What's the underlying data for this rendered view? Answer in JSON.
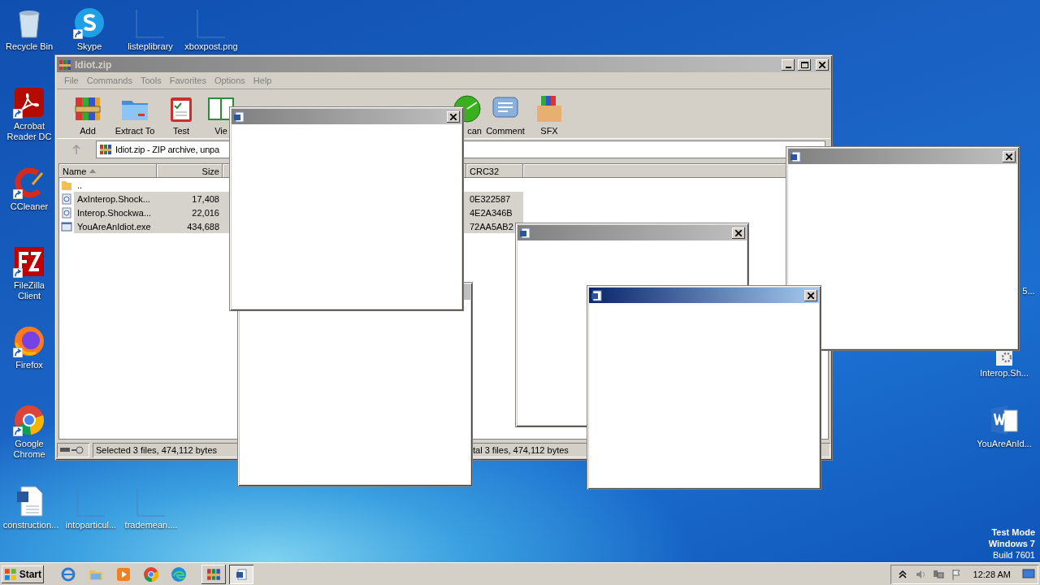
{
  "desktop_icons": [
    {
      "label": "Recycle Bin",
      "kind": "recycle-bin",
      "shortcut": false
    },
    {
      "label": "Skype",
      "kind": "skype",
      "shortcut": true
    },
    {
      "label": "listeplibrary",
      "kind": "blank",
      "shortcut": false
    },
    {
      "label": "xboxpost.png",
      "kind": "blank",
      "shortcut": false
    },
    {
      "label": "Acrobat Reader DC",
      "kind": "acrobat",
      "shortcut": true
    },
    {
      "label": "CCleaner",
      "kind": "ccleaner",
      "shortcut": true
    },
    {
      "label": "FileZilla Client",
      "kind": "filezilla",
      "shortcut": true
    },
    {
      "label": "Firefox",
      "kind": "firefox",
      "shortcut": true
    },
    {
      "label": "Google Chrome",
      "kind": "chrome",
      "shortcut": true
    },
    {
      "label": "construction...",
      "kind": "word-doc",
      "shortcut": false
    },
    {
      "label": "intoparticul...",
      "kind": "blank",
      "shortcut": false
    },
    {
      "label": "trademean....",
      "kind": "blank",
      "shortcut": false
    },
    {
      "label": "5...",
      "kind": "hidden"
    },
    {
      "label": "Interop.Sh...",
      "kind": "component",
      "shortcut": false
    },
    {
      "label": "YouAreAnId...",
      "kind": "word-app",
      "shortcut": false
    }
  ],
  "archive_window": {
    "title": "Idiot.zip",
    "active": false,
    "menu": [
      {
        "label": "File",
        "disabled": true
      },
      {
        "label": "Commands",
        "disabled": true
      },
      {
        "label": "Tools",
        "disabled": true
      },
      {
        "label": "Favorites",
        "disabled": true
      },
      {
        "label": "Options",
        "disabled": true
      },
      {
        "label": "Help",
        "disabled": true
      }
    ],
    "toolbar": [
      {
        "label": "Add",
        "kind": "add"
      },
      {
        "label": "Extract To",
        "kind": "extract"
      },
      {
        "label": "Test",
        "kind": "test"
      },
      {
        "label": "Vie",
        "kind": "view"
      },
      {
        "label": "can",
        "kind": "scan"
      },
      {
        "label": "Comment",
        "kind": "comment"
      },
      {
        "label": "SFX",
        "kind": "sfx"
      }
    ],
    "address": "Idiot.zip - ZIP archive, unpa",
    "columns": [
      {
        "label": "Name",
        "sorted": true
      },
      {
        "label": "Size",
        "sorted": false
      },
      {
        "label": "CRC32",
        "sorted": false
      }
    ],
    "rows": [
      {
        "name": "..",
        "kind": "folder",
        "selected": false
      },
      {
        "name": "AxInterop.Shock...",
        "kind": "dll",
        "size": "17,408",
        "crc": "0E322587",
        "selected": true
      },
      {
        "name": "Interop.Shockwa...",
        "kind": "dll",
        "size": "22,016",
        "crc": "4E2A346B",
        "selected": true
      },
      {
        "name": "YouAreAnIdiot.exe",
        "kind": "exe",
        "size": "434,688",
        "crc": "72AA5AB2",
        "selected": true
      }
    ],
    "status_left": "Selected 3 files, 474,112 bytes",
    "status_right": "tal 3 files, 474,112 bytes"
  },
  "popups": [
    {
      "active": false
    },
    {
      "active": false
    },
    {
      "active": false
    },
    {
      "active": false
    },
    {
      "active": true
    }
  ],
  "system_text": [
    "Test Mode",
    "Windows 7",
    "Build 7601"
  ],
  "taskbar": {
    "start": "Start",
    "quick_launch": [
      {
        "kind": "ie"
      },
      {
        "kind": "explorer"
      },
      {
        "kind": "media"
      },
      {
        "kind": "chrome"
      },
      {
        "kind": "edge"
      }
    ],
    "tasks": [
      {
        "kind": "winrar",
        "selected": false
      },
      {
        "kind": "word",
        "selected": true
      }
    ],
    "tray": [
      {
        "kind": "chevron"
      },
      {
        "kind": "volume"
      },
      {
        "kind": "network"
      },
      {
        "kind": "flag"
      }
    ],
    "clock": "12:28 AM"
  }
}
